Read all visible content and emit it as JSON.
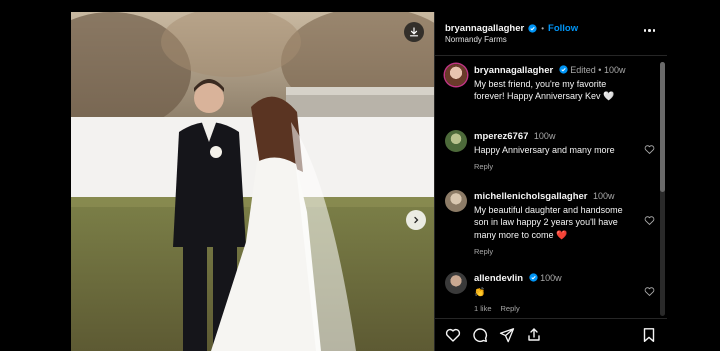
{
  "post": {
    "author": "bryannagallagher",
    "follow_label": "Follow",
    "separator": "•",
    "location": "Normandy Farms"
  },
  "comments": [
    {
      "username": "bryannagallagher",
      "edited": "Edited",
      "sep": "•",
      "time": "100w",
      "text": "My best friend, you're my favorite forever! Happy Anniversary Kev 🤍"
    },
    {
      "username": "mperez6767",
      "time": "100w",
      "text": "Happy Anniversary and many more",
      "reply_label": "Reply"
    },
    {
      "username": "michellenicholsgallagher",
      "time": "100w",
      "text": "My beautiful daughter and handsome son in law happy 2 years you'll have many more to come ❤️",
      "reply_label": "Reply"
    },
    {
      "username": "allendevlin",
      "time": "100w",
      "text": "👏",
      "likes": "1 like",
      "reply_label": "Reply"
    }
  ],
  "icons": {
    "download": "download-icon",
    "next": "chevron-right-icon",
    "verified": "verified-badge-icon",
    "more": "more-options-icon",
    "like": "heart-icon",
    "comment": "comment-icon",
    "share": "share-icon",
    "repost": "repost-icon",
    "save": "bookmark-icon"
  },
  "colors": {
    "accent": "#0095f6",
    "background": "#000000",
    "text": "#f5f5f5",
    "muted": "#a8a8a8"
  }
}
